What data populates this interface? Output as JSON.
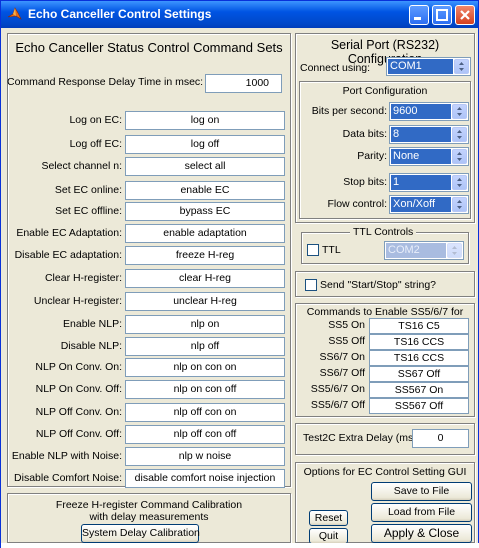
{
  "window": {
    "title": "Echo Canceller Control Settings"
  },
  "left": {
    "title": "Echo Canceller Status Control Command Sets",
    "delay": {
      "label": "Command Response Delay Time in msec:",
      "value": "1000"
    },
    "commands": [
      {
        "label": "Log on EC:",
        "value": "log on"
      },
      {
        "label": "Log off EC:",
        "value": "log off"
      },
      {
        "label": "Select channel n:",
        "value": "select all"
      },
      {
        "label": "Set EC online:",
        "value": "enable EC"
      },
      {
        "label": "Set EC offline:",
        "value": "bypass EC"
      },
      {
        "label": "Enable EC Adaptation:",
        "value": "enable adaptation"
      },
      {
        "label": "Disable EC adaptation:",
        "value": "freeze H-reg"
      },
      {
        "label": "Clear H-register:",
        "value": "clear H-reg"
      },
      {
        "label": "Unclear H-register:",
        "value": "unclear H-reg"
      },
      {
        "label": "Enable NLP:",
        "value": "nlp on"
      },
      {
        "label": "Disable NLP:",
        "value": "nlp off"
      },
      {
        "label": "NLP On Conv. On:",
        "value": "nlp on con on"
      },
      {
        "label": "NLP On Conv. Off:",
        "value": "nlp on con off"
      },
      {
        "label": "NLP Off Conv. On:",
        "value": "nlp off con on"
      },
      {
        "label": "NLP Off Conv. Off:",
        "value": "nlp off con off"
      },
      {
        "label": "Enable NLP with Noise:",
        "value": "nlp w noise"
      },
      {
        "label": "Disable Comfort Noise:",
        "value": "disable comfort noise injection"
      }
    ],
    "calibration": {
      "title_line1": "Freeze H-register Command Calibration",
      "title_line2": "with delay measurements",
      "button": "System Delay Calibration"
    }
  },
  "serial": {
    "title": "Serial Port (RS232) Configuration",
    "connect_label": "Connect using:",
    "connect_value": "COM1",
    "port_config_title": "Port Configuration",
    "rows": [
      {
        "label": "Bits per second:",
        "value": "9600"
      },
      {
        "label": "Data bits:",
        "value": "8"
      },
      {
        "label": "Parity:",
        "value": "None"
      },
      {
        "label": "Stop bits:",
        "value": "1"
      },
      {
        "label": "Flow control:",
        "value": "Xon/Xoff"
      }
    ]
  },
  "ttl": {
    "title": "TTL Controls",
    "label": "TTL",
    "checked": false,
    "port": "COM2"
  },
  "send_startstop": {
    "label": "Send \"Start/Stop\" string?",
    "checked": false
  },
  "ss_commands": {
    "title": "Commands to Enable SS5/6/7 for Test 8",
    "rows": [
      {
        "label": "SS5 On",
        "value": "TS16 C5"
      },
      {
        "label": "SS5 Off",
        "value": "TS16 CCS"
      },
      {
        "label": "SS6/7 On",
        "value": "TS16 CCS"
      },
      {
        "label": "SS6/7 Off",
        "value": "SS67 Off"
      },
      {
        "label": "SS5/6/7 On",
        "value": "SS567 On"
      },
      {
        "label": "SS5/6/7 Off",
        "value": "SS567 Off"
      }
    ]
  },
  "test2c": {
    "label": "Test2C Extra Delay (ms):",
    "value": "0"
  },
  "options": {
    "title": "Options for EC Control Setting GUI",
    "save": "Save to File",
    "load": "Load from File",
    "apply": "Apply & Close",
    "reset": "Reset",
    "quit": "Quit"
  },
  "colors": {
    "titlebar": "#0054e3",
    "selection": "#316ac5",
    "face": "#ece9d8"
  }
}
